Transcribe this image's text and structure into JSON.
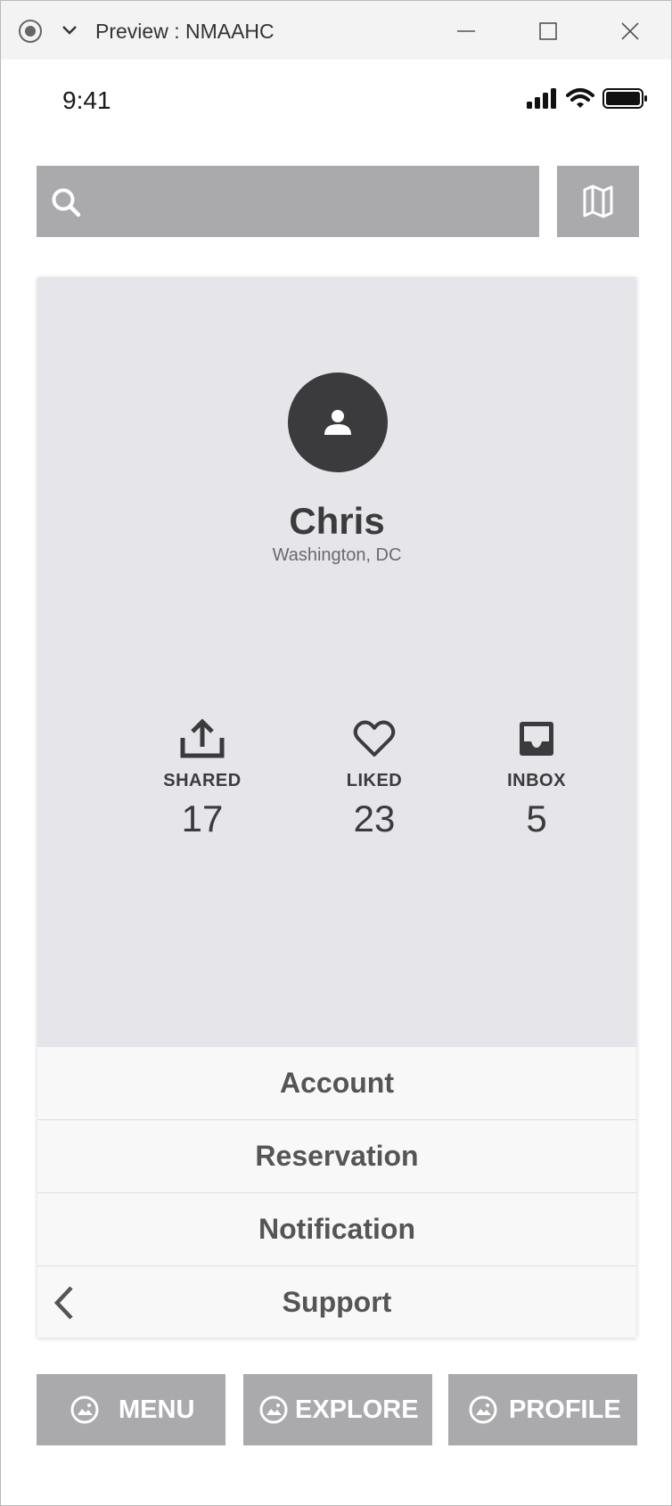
{
  "window": {
    "title": "Preview : NMAAHC"
  },
  "status_bar": {
    "time": "9:41"
  },
  "profile": {
    "name": "Chris",
    "location": "Washington, DC"
  },
  "stats": [
    {
      "label": "SHARED",
      "value": "17",
      "icon": "share-icon"
    },
    {
      "label": "LIKED",
      "value": "23",
      "icon": "heart-icon"
    },
    {
      "label": "INBOX",
      "value": "5",
      "icon": "inbox-icon"
    }
  ],
  "menu": [
    {
      "label": "Account"
    },
    {
      "label": "Reservation"
    },
    {
      "label": "Notification"
    },
    {
      "label": "Support"
    }
  ],
  "tabs": [
    {
      "label": "MENU",
      "icon": "image-circle-icon"
    },
    {
      "label": "EXPLORE",
      "icon": "image-circle-icon"
    },
    {
      "label": "PROFILE",
      "icon": "image-circle-icon"
    }
  ],
  "colors": {
    "placeholder_gray": "#aaaaad",
    "card_background": "#e5e5ea",
    "dark_text": "#3b3b3d",
    "list_background": "#f8f8f8"
  }
}
